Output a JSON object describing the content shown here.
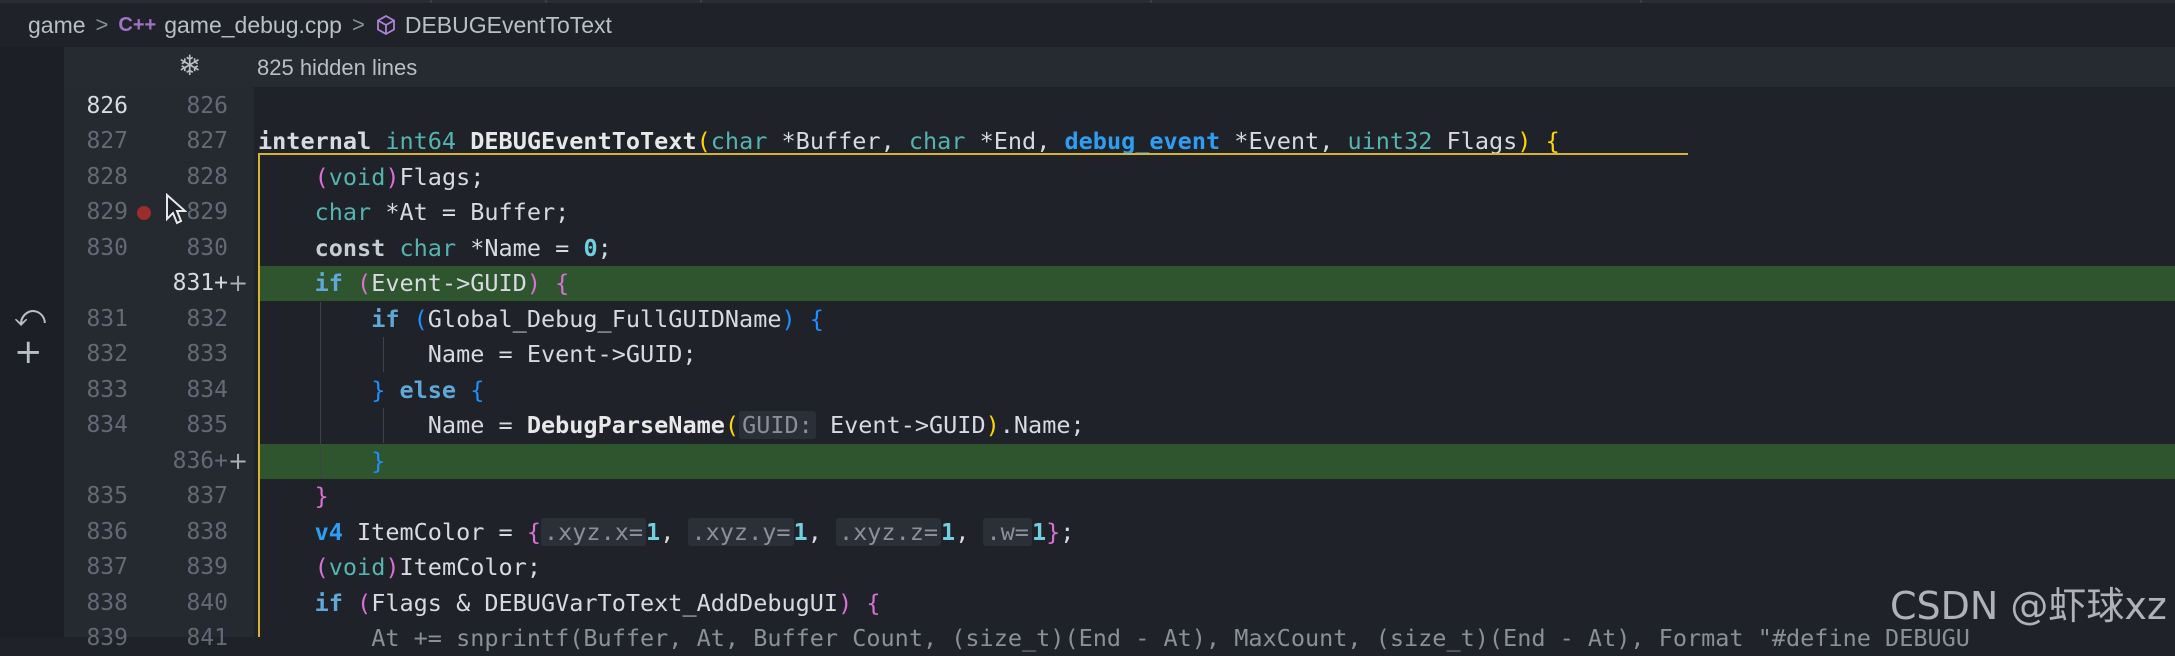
{
  "breadcrumb": {
    "items": [
      "game",
      "game_debug.cpp",
      "DEBUGEventToText"
    ],
    "separator": ">"
  },
  "cpp_icon": "C++",
  "hidden_lines": "825 hidden lines",
  "colors": {
    "background": "#1f2229",
    "gutter": "#252930",
    "added_line": "#2e552d",
    "scope_guide": "#d6b330",
    "breakpoint": "#9b2d2d"
  },
  "icons": {
    "breadcrumb_file": "cpp-file-icon",
    "breadcrumb_symbol": "cube-icon",
    "hidden_lines": "snowflake-icon",
    "diff_revert": "revert-icon",
    "diff_add": "plus-icon",
    "mouse": "cursor-icon"
  },
  "lines": [
    {
      "old": "826",
      "new": "826",
      "current": true
    },
    {
      "old": "827",
      "new": "827"
    },
    {
      "old": "828",
      "new": "828"
    },
    {
      "old": "829",
      "new": "829",
      "breakpoint": true
    },
    {
      "old": "830",
      "new": "830"
    },
    {
      "old": "",
      "new": "831+",
      "added": true
    },
    {
      "old": "831",
      "new": "832"
    },
    {
      "old": "832",
      "new": "833"
    },
    {
      "old": "833",
      "new": "834"
    },
    {
      "old": "834",
      "new": "835"
    },
    {
      "old": "",
      "new": "836+",
      "added": true
    },
    {
      "old": "835",
      "new": "837"
    },
    {
      "old": "836",
      "new": "838"
    },
    {
      "old": "837",
      "new": "839"
    },
    {
      "old": "838",
      "new": "840"
    },
    {
      "old": "839",
      "new": "841"
    }
  ],
  "code": {
    "l827": {
      "internal": "internal",
      "int64": "int64",
      "fname": "DEBUGEventToText",
      "open": "(",
      "char1": "char",
      "p1": " *",
      "buffer": "Buffer",
      "c1": ", ",
      "char2": "char",
      "p2": " *",
      "end": "End",
      "c2": ", ",
      "debug_event": "debug_event",
      "p3": " *",
      "event": "Event",
      "c3": ", ",
      "uint32": "uint32",
      "flags": " Flags",
      "close": ")",
      "brace": " {"
    },
    "l828": {
      "open": "(",
      "void": "void",
      "close": ")",
      "rest": "Flags;"
    },
    "l829": {
      "char": "char",
      "rest": " *At = Buffer;"
    },
    "l830": {
      "const": "const",
      "char": "char",
      "mid": " *Name = ",
      "zero": "0",
      "semi": ";"
    },
    "l831": {
      "if": "if",
      "open": " (",
      "expr": "Event->GUID",
      "close": ")",
      "brace": " {"
    },
    "l832": {
      "if": "if",
      "open": " (",
      "expr": "Global_Debug_FullGUIDName",
      "close": ")",
      "brace": " {"
    },
    "l833": {
      "text": "Name = Event->GUID;"
    },
    "l834": {
      "close": "}",
      "else": " else",
      "brace": " {"
    },
    "l835": {
      "pre": "Name = ",
      "fn": "DebugParseName",
      "open": "(",
      "hint": "GUID:",
      "arg": " Event->GUID",
      "close": ")",
      "post": ".Name;"
    },
    "l836": {
      "close": "}"
    },
    "l837": {
      "close": "}"
    },
    "l838": {
      "v4": "v4",
      "pre": " ItemColor = ",
      "open": "{",
      "f1": ".xyz.x=",
      "v1": "1",
      "c1": ", ",
      "f2": ".xyz.y=",
      "v2": "1",
      "c2": ", ",
      "f3": ".xyz.z=",
      "v3": "1",
      "c3": ", ",
      "f4": ".w=",
      "v4v": "1",
      "close": "}",
      "semi": ";"
    },
    "l839": {
      "open": "(",
      "void": "void",
      "close": ")",
      "rest": "ItemColor;"
    },
    "l840": {
      "if": "if",
      "open": " (",
      "expr": "Flags & DEBUGVarToText_AddDebugUI",
      "close": ")",
      "brace": " {"
    },
    "l841": {
      "text": "At += snprintf(Buffer, At, Buffer Count, (size_t)(End - At), MaxCount, (size_t)(End - At), Format \"#define DEBUGU"
    }
  },
  "watermark": "CSDN @虾球xz"
}
